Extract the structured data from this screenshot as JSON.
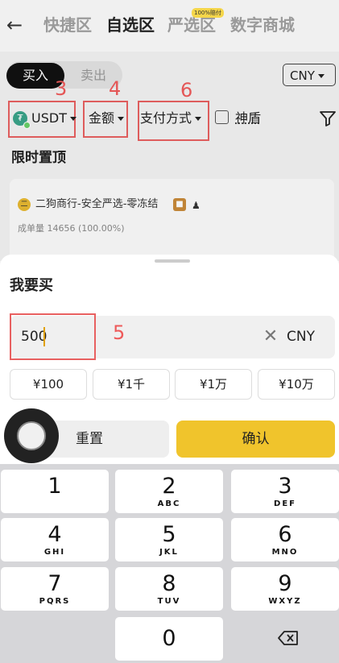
{
  "nav": {
    "back_icon": "arrow-left-icon",
    "tabs": [
      "快捷区",
      "自选区",
      "严选区",
      "数字商城"
    ],
    "active_tab": "自选区",
    "badge": "100%赔付"
  },
  "trade": {
    "buy": "买入",
    "sell": "卖出"
  },
  "currency_select": "CNY",
  "filters": {
    "coin": "USDT",
    "amount": "金额",
    "payment": "支付方式",
    "shield": "神盾",
    "labels": {
      "coin": "3",
      "amount": "4",
      "payment": "6",
      "input": "5"
    }
  },
  "section": {
    "title": "限时置顶"
  },
  "merchant": {
    "name": "二狗商行-安全严选-零冻结",
    "volume": "成单量 14656 (100.00%)"
  },
  "sheet": {
    "title": "我要买",
    "amount": "500",
    "currency": "CNY",
    "quick": [
      "¥100",
      "¥1千",
      "¥1万",
      "¥10万"
    ],
    "reset": "重置",
    "confirm": "确认"
  },
  "keypad": {
    "keys": [
      {
        "n": "1",
        "l": ""
      },
      {
        "n": "2",
        "l": "ABC"
      },
      {
        "n": "3",
        "l": "DEF"
      },
      {
        "n": "4",
        "l": "GHI"
      },
      {
        "n": "5",
        "l": "JKL"
      },
      {
        "n": "6",
        "l": "MNO"
      },
      {
        "n": "7",
        "l": "PQRS"
      },
      {
        "n": "8",
        "l": "TUV"
      },
      {
        "n": "9",
        "l": "WXYZ"
      },
      {
        "n": "0",
        "l": ""
      }
    ]
  },
  "colors": {
    "accent": "#f0c42c",
    "annotation": "#e86060",
    "tether": "#3aa389"
  }
}
